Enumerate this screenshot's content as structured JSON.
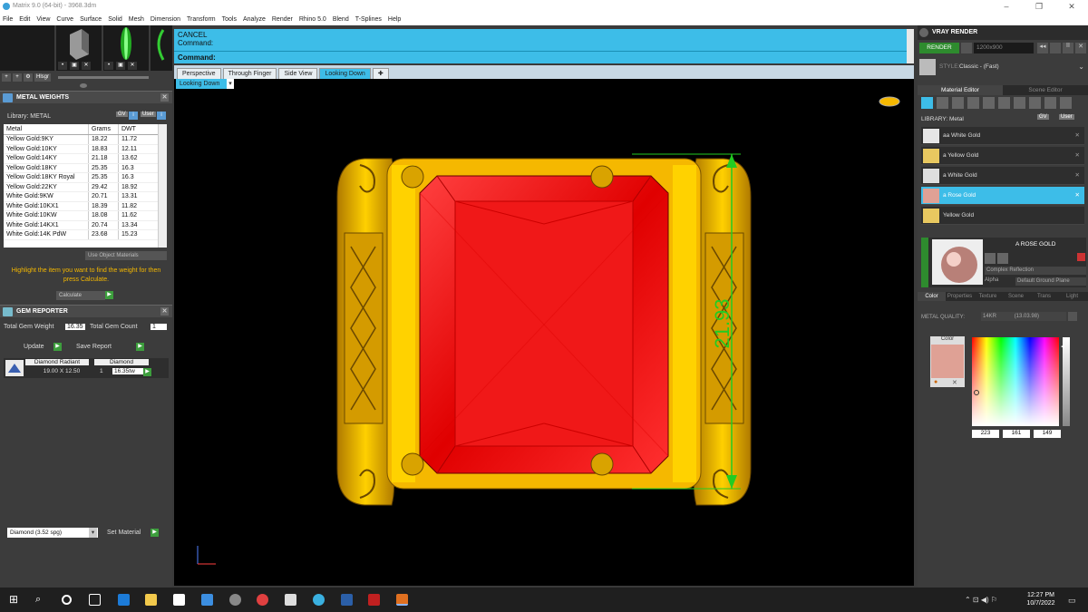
{
  "window": {
    "title": "Matrix 9.0 (64-bit) - 3968.3dm"
  },
  "menu": [
    "File",
    "Edit",
    "View",
    "Curve",
    "Surface",
    "Solid",
    "Mesh",
    "Dimension",
    "Transform",
    "Tools",
    "Analyze",
    "Render",
    "Rhino 5.0",
    "Blend",
    "T-Splines",
    "Help"
  ],
  "thumb_button": "Hlsgr",
  "metal_weights": {
    "title": "METAL WEIGHTS",
    "library_label": "Library: METAL",
    "btn_gv": "GV",
    "btn_user": "User",
    "columns": [
      "Metal",
      "Grams",
      "DWT"
    ],
    "rows": [
      [
        "Yellow Gold:9KY",
        "18.22",
        "11.72"
      ],
      [
        "Yellow Gold:10KY",
        "18.83",
        "12.11"
      ],
      [
        "Yellow Gold:14KY",
        "21.18",
        "13.62"
      ],
      [
        "Yellow Gold:18KY",
        "25.35",
        "16.3"
      ],
      [
        "Yellow Gold:18KY Royal",
        "25.35",
        "16.3"
      ],
      [
        "Yellow Gold:22KY",
        "29.42",
        "18.92"
      ],
      [
        "White Gold:9KW",
        "20.71",
        "13.31"
      ],
      [
        "White Gold:10KX1",
        "18.39",
        "11.82"
      ],
      [
        "White Gold:10KW",
        "18.08",
        "11.62"
      ],
      [
        "White Gold:14KX1",
        "20.74",
        "13.34"
      ],
      [
        "White Gold:14K PdW",
        "23.68",
        "15.23"
      ]
    ],
    "use_object_materials": "Use Object Materials",
    "hint": "Highlight the item you want to find the weight for then press Calculate.",
    "calculate": "Calculate"
  },
  "gem_reporter": {
    "title": "GEM REPORTER",
    "total_weight_label": "Total Gem Weight",
    "total_weight": "16.35",
    "total_count_label": "Total Gem Count",
    "total_count": "1",
    "update": "Update",
    "save_report": "Save Report",
    "gem_name": "Diamond Radiant",
    "gem_type": "Diamond",
    "gem_size": "19.00 X 12.50",
    "gem_qty": "1",
    "gem_weight": "16.35tw",
    "material_select": "Diamond    (3.52 spg)",
    "set_material": "Set Material"
  },
  "command": {
    "line1": "CANCEL",
    "line2": "Command:",
    "prompt": "Command:"
  },
  "viewport": {
    "tabs": [
      "Perspective",
      "Through Finger",
      "Side View",
      "Looking Down"
    ],
    "active_tab": 3,
    "label": "Looking Down",
    "dimension": "21.93",
    "colors": {
      "gold": "#f5b800",
      "gem": "#ff1a1a",
      "dim": "#22cc22"
    }
  },
  "vray": {
    "title": "VRAY RENDER",
    "render_btn": "RENDER",
    "resolution": "1200x900",
    "style_label": "STYLE:",
    "style_value": "Classic - (Fast)",
    "tab_material": "Material Editor",
    "tab_scene": "Scene Editor",
    "library_label": "LIBRARY: Metal",
    "btn_gv": "GV",
    "btn_user": "User",
    "materials": [
      "aa White Gold",
      "a Yellow Gold",
      "a White Gold",
      "a Rose Gold",
      "Yellow Gold"
    ],
    "selected_material": 3,
    "preview_name": "A ROSE GOLD",
    "reflection": "Complex Reflection",
    "alpha_label": "Alpha",
    "ground_plane": "Default Ground Plane",
    "subtabs": [
      "Color",
      "Properties",
      "Texture",
      "Scene",
      "Trans",
      "Light"
    ],
    "metal_quality_label": "METAL QUALITY:",
    "metal_quality": "14KR",
    "metal_quality_extra": "(13.03.98)",
    "color_label": "Color",
    "rgb": [
      "223",
      "161",
      "149"
    ],
    "swatch_color": "#dfa195"
  },
  "taskbar": {
    "time": "12:27 PM",
    "date": "10/7/2022"
  }
}
